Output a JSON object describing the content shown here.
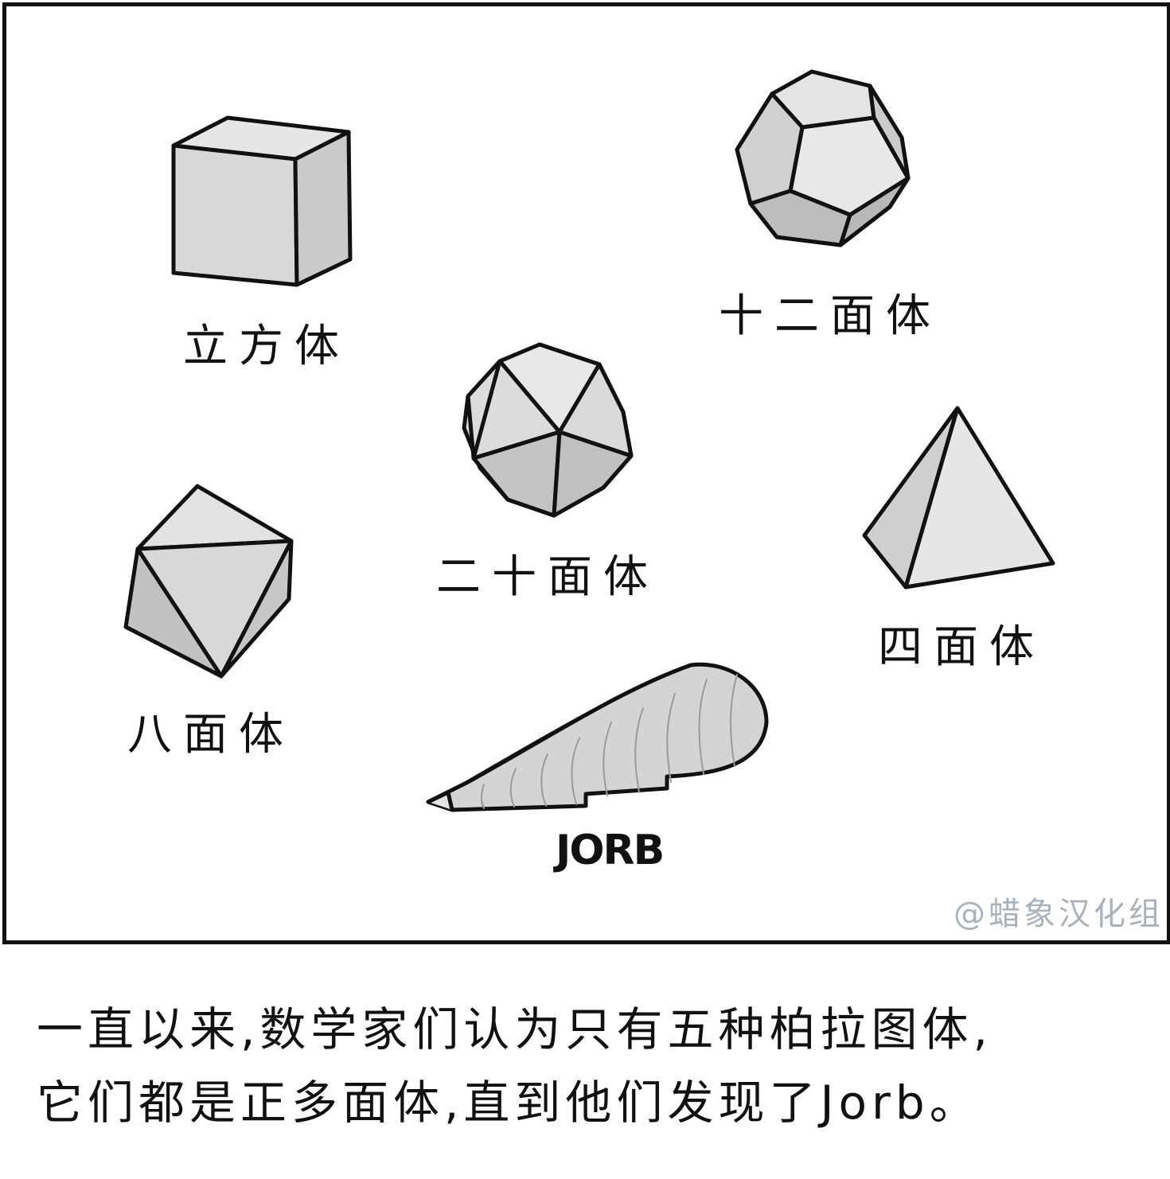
{
  "shapes": [
    {
      "name": "cube",
      "label": "立方体"
    },
    {
      "name": "dodecahedron",
      "label": "十二面体"
    },
    {
      "name": "icosahedron",
      "label": "二十面体"
    },
    {
      "name": "tetrahedron",
      "label": "四面体"
    },
    {
      "name": "octahedron",
      "label": "八面体"
    },
    {
      "name": "jorb",
      "label": "JORB"
    }
  ],
  "watermark": "@蜡象汉化组",
  "caption": {
    "line1": "一直以来,数学家们认为只有五种柏拉图体,",
    "line2": "它们都是正多面体,直到他们发现了Jorb。"
  },
  "colors": {
    "light_face": "#e6e6e6",
    "mid_face": "#d2d2d2",
    "dark_face": "#bdbdbd",
    "stroke": "#111111",
    "watermark": "#a8b2bc"
  }
}
